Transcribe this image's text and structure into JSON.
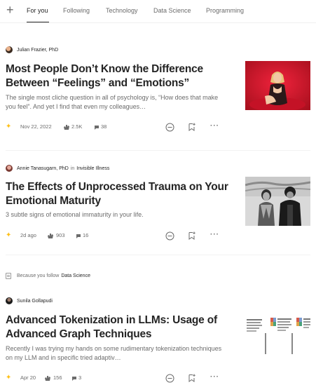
{
  "tabs": {
    "add_glyph": "+",
    "items": [
      {
        "label": "For you",
        "active": true
      },
      {
        "label": "Following"
      },
      {
        "label": "Technology"
      },
      {
        "label": "Data Science"
      },
      {
        "label": "Programming"
      }
    ]
  },
  "articles": [
    {
      "author": "Julian Frazier, PhD",
      "publication": "",
      "title": "Most People Don’t Know the Difference Between “Feelings” and “Emotions”",
      "subtitle": "The single most cliche question in all of psychology is, “How does that make you feel”. And yet I find that even my colleagues…",
      "date": "Nov 22, 2022",
      "claps": "2.5K",
      "responses": "38",
      "member_only": true
    },
    {
      "author": "Annie Tanasugarn, PhD",
      "in_word": "in",
      "publication": "Invisible Illness",
      "title": "The Effects of Unprocessed Trauma on Your Emotional Maturity",
      "subtitle": "3 subtle signs of emotional immaturity in your life.",
      "date": "2d ago",
      "claps": "903",
      "responses": "16",
      "member_only": true
    },
    {
      "reason_prefix": "Because you follow",
      "reason_topic": "Data Science",
      "author": "Sunila Gollapudi",
      "publication": "",
      "title": "Advanced Tokenization in LLMs: Usage of Advanced Graph Techniques",
      "subtitle": "Recently I was trying my hands on some rudimentary tokenization techniques on my LLM and in specific tried adaptiv…",
      "date": "Apr 20",
      "claps": "156",
      "responses": "3",
      "member_only": true
    }
  ],
  "icons": {
    "member": "star-icon",
    "claps": "clap-icon",
    "responses": "comment-icon",
    "dismiss": "show-less-icon",
    "save": "bookmark-add-icon",
    "more": "more-icon"
  },
  "colors": {
    "text": "#242424",
    "muted": "#6b6b6b",
    "member_star": "#ffc017",
    "divider": "#f2f2f2"
  }
}
